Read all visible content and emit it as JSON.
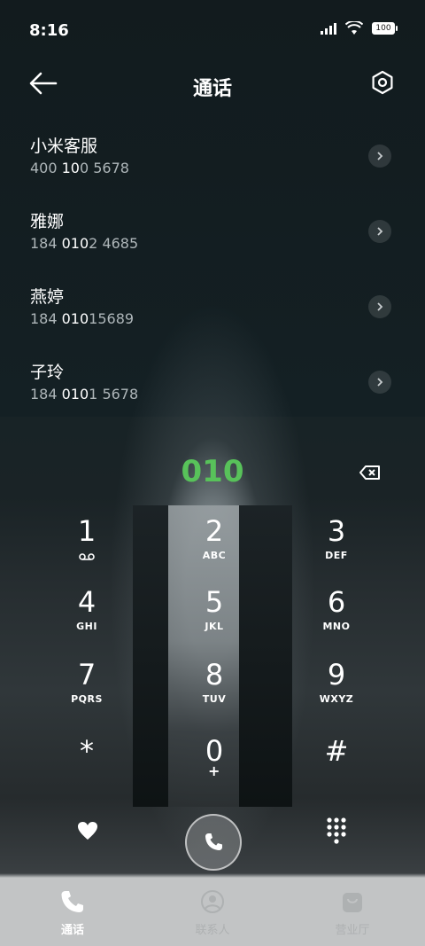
{
  "status_bar": {
    "time": "8:16",
    "battery": "100"
  },
  "header": {
    "title": "通话"
  },
  "icons": {
    "back": "back-arrow-icon",
    "settings": "settings-hex-icon",
    "chevron": "chevron-right-icon",
    "backspace": "backspace-icon",
    "favorite": "heart-icon",
    "call": "phone-icon",
    "keypad": "dialpad-icon"
  },
  "results": [
    {
      "name": "小米客服",
      "number_pre": "400 ",
      "number_hl": "10",
      "number_post": "0 5678"
    },
    {
      "name": "雅娜",
      "number_pre": "184 ",
      "number_hl": "010",
      "number_post": "2 4685"
    },
    {
      "name": "燕婷",
      "number_pre": "184 ",
      "number_hl": "010",
      "number_post": "15689"
    },
    {
      "name": "子玲",
      "number_pre": "184 ",
      "number_hl": "010",
      "number_post": "1 5678"
    }
  ],
  "dialer": {
    "input": "010"
  },
  "keys": [
    {
      "num": "1",
      "sub": ""
    },
    {
      "num": "2",
      "sub": "ABC"
    },
    {
      "num": "3",
      "sub": "DEF"
    },
    {
      "num": "4",
      "sub": "GHI"
    },
    {
      "num": "5",
      "sub": "JKL"
    },
    {
      "num": "6",
      "sub": "MNO"
    },
    {
      "num": "7",
      "sub": "PQRS"
    },
    {
      "num": "8",
      "sub": "TUV"
    },
    {
      "num": "9",
      "sub": "WXYZ"
    },
    {
      "num": "*",
      "sub": ""
    },
    {
      "num": "0",
      "sub": "+"
    },
    {
      "num": "#",
      "sub": ""
    }
  ],
  "tabs": [
    {
      "label": "通话",
      "icon": "phone-icon"
    },
    {
      "label": "联系人",
      "icon": "contact-icon"
    },
    {
      "label": "营业厅",
      "icon": "store-bag-icon"
    }
  ],
  "colors": {
    "digits": "#58c25a",
    "tab_active": "#ffffff",
    "tab_inactive": "#aeb1b2"
  }
}
